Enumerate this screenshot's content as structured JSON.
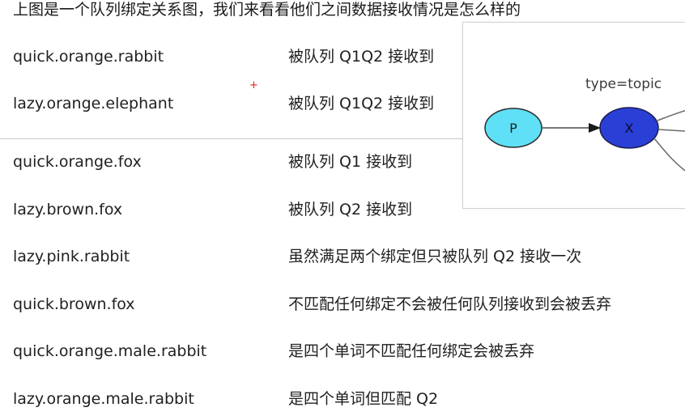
{
  "header": {
    "text": "上图是一个队列绑定关系图，我们来看看他们之间数据接收情况是怎么样的"
  },
  "rows": [
    {
      "key": "quick.orange.rabbit",
      "desc": "被队列 Q1Q2 接收到"
    },
    {
      "key": "lazy.orange.elephant",
      "desc": "被队列 Q1Q2 接收到"
    },
    {
      "key": "quick.orange.fox",
      "desc": "被队列 Q1 接收到"
    },
    {
      "key": "lazy.brown.fox",
      "desc": "被队列 Q2 接收到"
    },
    {
      "key": "lazy.pink.rabbit",
      "desc": "虽然满足两个绑定但只被队列 Q2 接收一次"
    },
    {
      "key": "quick.brown.fox",
      "desc": "不匹配任何绑定不会被任何队列接收到会被丢弃"
    },
    {
      "key": "quick.orange.male.rabbit",
      "desc": "是四个单词不匹配任何绑定会被丢弃"
    },
    {
      "key": "lazy.orange.male.rabbit",
      "desc": "是四个单词但匹配 Q2"
    }
  ],
  "diagram": {
    "exchange_type_label": "type=topic",
    "producer_label": "P",
    "exchange_label": "X",
    "producer_color": "#5fe0f7",
    "exchange_color": "#2a3fd6"
  },
  "marker": {
    "symbol": "+",
    "color": "#e02020"
  }
}
